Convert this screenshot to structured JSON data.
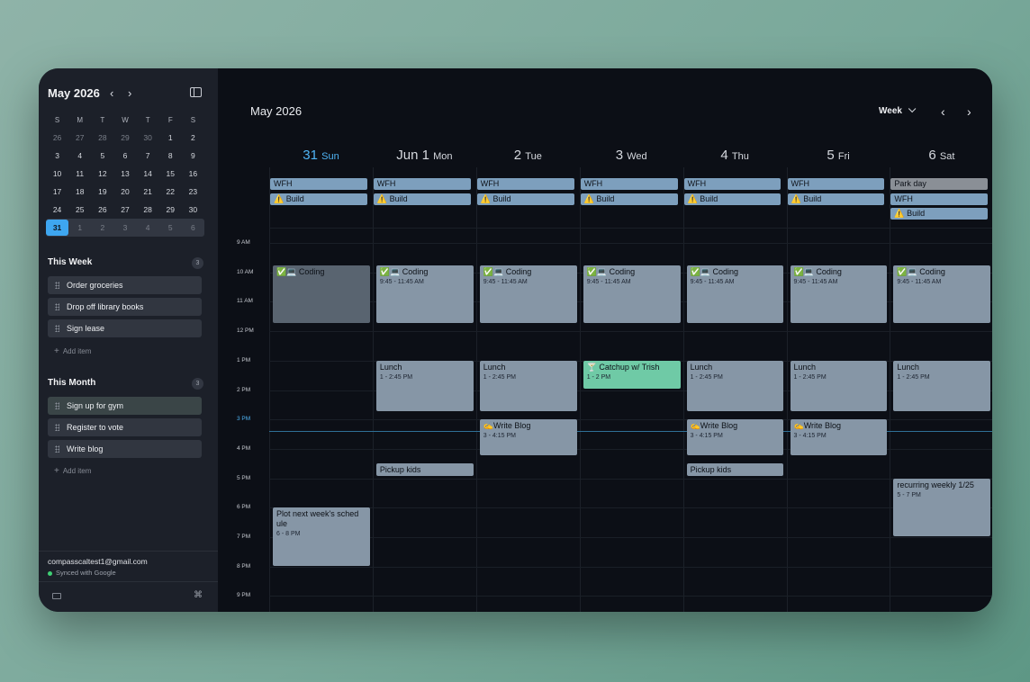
{
  "sidebar": {
    "month_label": "May 2026",
    "prev_arrow": "‹",
    "next_arrow": "›",
    "weekday_heads": [
      "S",
      "M",
      "T",
      "W",
      "T",
      "F",
      "S"
    ],
    "weeks": [
      [
        "26",
        "27",
        "28",
        "29",
        "30",
        "1",
        "2"
      ],
      [
        "3",
        "4",
        "5",
        "6",
        "7",
        "8",
        "9"
      ],
      [
        "10",
        "11",
        "12",
        "13",
        "14",
        "15",
        "16"
      ],
      [
        "17",
        "18",
        "19",
        "20",
        "21",
        "22",
        "23"
      ],
      [
        "24",
        "25",
        "26",
        "27",
        "28",
        "29",
        "30"
      ],
      [
        "31",
        "1",
        "2",
        "3",
        "4",
        "5",
        "6"
      ]
    ],
    "this_week": {
      "title": "This Week",
      "count": "3",
      "items": [
        "Order groceries",
        "Drop off library books",
        "Sign lease"
      ],
      "add_label": "Add item"
    },
    "this_month": {
      "title": "This Month",
      "count": "3",
      "items": [
        "Sign up for gym",
        "Register to vote",
        "Write blog"
      ],
      "add_label": "Add item"
    },
    "account": {
      "email": "compasscaltest1@gmail.com",
      "sync_status": "Synced with Google"
    }
  },
  "main": {
    "month_title": "May 2026",
    "view": "Week",
    "prev_arrow": "‹",
    "next_arrow": "›",
    "days": [
      {
        "num": "31",
        "wd": "Sun",
        "today": true
      },
      {
        "num": "Jun 1",
        "wd": "Mon"
      },
      {
        "num": "2",
        "wd": "Tue"
      },
      {
        "num": "3",
        "wd": "Wed"
      },
      {
        "num": "4",
        "wd": "Thu"
      },
      {
        "num": "5",
        "wd": "Fri"
      },
      {
        "num": "6",
        "wd": "Sat"
      }
    ],
    "hours": [
      "9 AM",
      "10 AM",
      "11 AM",
      "12 PM",
      "1 PM",
      "2 PM",
      "3 PM",
      "4 PM",
      "5 PM",
      "6 PM",
      "7 PM",
      "8 PM",
      "9 PM"
    ],
    "current_hour_label": "3 PM",
    "allday": [
      {
        "day": 0,
        "row": 0,
        "title": "WFH",
        "style": "blue"
      },
      {
        "day": 0,
        "row": 1,
        "title": "⚠️ Build",
        "style": "blue"
      },
      {
        "day": 1,
        "row": 0,
        "title": "WFH",
        "style": "blue"
      },
      {
        "day": 1,
        "row": 1,
        "title": "⚠️ Build",
        "style": "blue"
      },
      {
        "day": 2,
        "row": 0,
        "title": "WFH",
        "style": "blue"
      },
      {
        "day": 2,
        "row": 1,
        "title": "⚠️ Build",
        "style": "blue"
      },
      {
        "day": 3,
        "row": 0,
        "title": "WFH",
        "style": "blue"
      },
      {
        "day": 3,
        "row": 1,
        "title": "⚠️ Build",
        "style": "blue"
      },
      {
        "day": 4,
        "row": 0,
        "title": "WFH",
        "style": "blue"
      },
      {
        "day": 4,
        "row": 1,
        "title": "⚠️ Build",
        "style": "blue"
      },
      {
        "day": 5,
        "row": 0,
        "title": "WFH",
        "style": "blue"
      },
      {
        "day": 5,
        "row": 1,
        "title": "⚠️ Build",
        "style": "blue"
      },
      {
        "day": 6,
        "row": 0,
        "title": "Park day",
        "style": "gray"
      },
      {
        "day": 6,
        "row": 1,
        "title": "WFH",
        "style": "blue"
      },
      {
        "day": 6,
        "row": 2,
        "title": "⚠️ Build",
        "style": "blue"
      }
    ],
    "events": [
      {
        "day": 0,
        "start": 9.75,
        "end": 11.75,
        "title": "✅💻 Coding",
        "time": "",
        "style": "past"
      },
      {
        "day": 1,
        "start": 9.75,
        "end": 11.75,
        "title": "✅💻 Coding",
        "time": "9:45 - 11:45 AM"
      },
      {
        "day": 2,
        "start": 9.75,
        "end": 11.75,
        "title": "✅💻 Coding",
        "time": "9:45 - 11:45 AM"
      },
      {
        "day": 3,
        "start": 9.75,
        "end": 11.75,
        "title": "✅💻 Coding",
        "time": "9:45 - 11:45 AM"
      },
      {
        "day": 4,
        "start": 9.75,
        "end": 11.75,
        "title": "✅💻 Coding",
        "time": "9:45 - 11:45 AM"
      },
      {
        "day": 5,
        "start": 9.75,
        "end": 11.75,
        "title": "✅💻 Coding",
        "time": "9:45 - 11:45 AM"
      },
      {
        "day": 6,
        "start": 9.75,
        "end": 11.75,
        "title": "✅💻 Coding",
        "time": "9:45 - 11:45 AM"
      },
      {
        "day": 1,
        "start": 13,
        "end": 14.75,
        "title": "Lunch",
        "time": "1 - 2:45 PM"
      },
      {
        "day": 2,
        "start": 13,
        "end": 14.75,
        "title": "Lunch",
        "time": "1 - 2:45 PM"
      },
      {
        "day": 3,
        "start": 13,
        "end": 14,
        "title": "🍸 Catchup w/ Trish",
        "time": "1 - 2 PM",
        "style": "green"
      },
      {
        "day": 4,
        "start": 13,
        "end": 14.75,
        "title": "Lunch",
        "time": "1 - 2:45 PM"
      },
      {
        "day": 5,
        "start": 13,
        "end": 14.75,
        "title": "Lunch",
        "time": "1 - 2:45 PM"
      },
      {
        "day": 6,
        "start": 13,
        "end": 14.75,
        "title": "Lunch",
        "time": "1 - 2:45 PM"
      },
      {
        "day": 2,
        "start": 15,
        "end": 16.25,
        "title": "✍️Write Blog",
        "time": "3 - 4:15 PM"
      },
      {
        "day": 4,
        "start": 15,
        "end": 16.25,
        "title": "✍️Write Blog",
        "time": "3 - 4:15 PM"
      },
      {
        "day": 5,
        "start": 15,
        "end": 16.25,
        "title": "✍️Write Blog",
        "time": "3 - 4:15 PM"
      },
      {
        "day": 1,
        "start": 16.5,
        "end": 16.95,
        "title": "Pickup kids",
        "time": ""
      },
      {
        "day": 4,
        "start": 16.5,
        "end": 16.95,
        "title": "Pickup kids",
        "time": ""
      },
      {
        "day": 6,
        "start": 17,
        "end": 19,
        "title": "recurring weekly 1/25",
        "time": "5 - 7 PM"
      },
      {
        "day": 0,
        "start": 18,
        "end": 20,
        "title": "Plot next week's sched ule",
        "time": "6 - 8 PM"
      }
    ],
    "now_hour": 15.4
  }
}
